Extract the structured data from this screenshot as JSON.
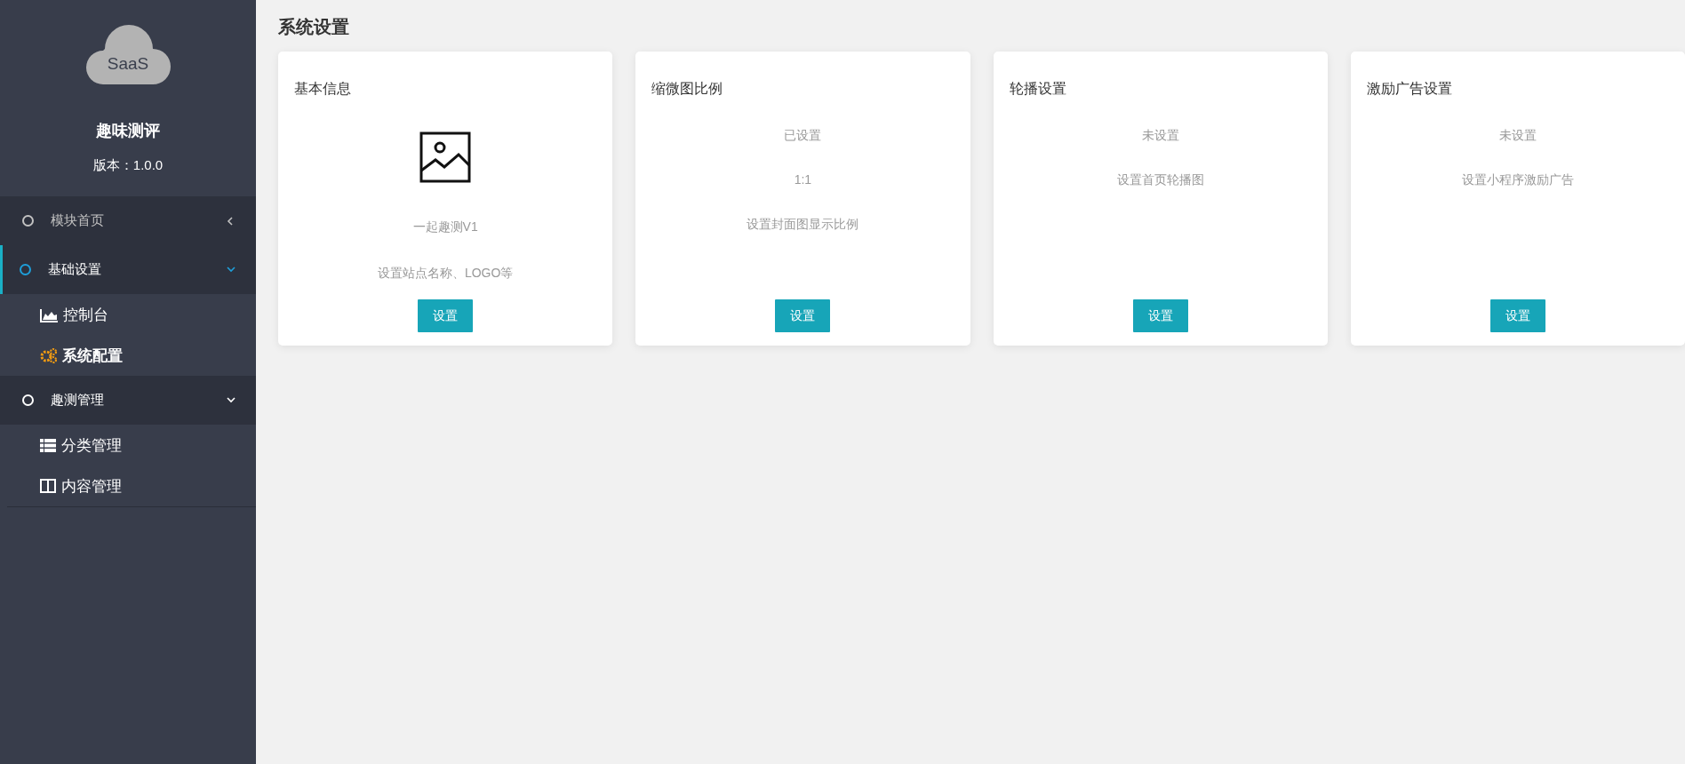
{
  "sidebar": {
    "logo": {
      "text": "SaaS"
    },
    "app_name": "趣味测评",
    "version": "版本：1.0.0",
    "menu": [
      {
        "label": "模块首页",
        "selected": false,
        "expanded": false
      },
      {
        "label": "基础设置",
        "selected": true,
        "expanded": true,
        "children": [
          {
            "label": "控制台",
            "kind": "chart",
            "selected": false
          },
          {
            "label": "系统配置",
            "kind": "gears",
            "selected": true
          }
        ]
      },
      {
        "label": "趣测管理",
        "selected": false,
        "expanded": true,
        "children": [
          {
            "label": "分类管理",
            "kind": "list",
            "selected": false
          },
          {
            "label": "内容管理",
            "kind": "columns",
            "selected": false
          }
        ]
      }
    ]
  },
  "page": {
    "title": "系统设置",
    "cards": [
      {
        "kind": "image",
        "title": "基本信息",
        "lines": [
          "一起趣测V1",
          "设置站点名称、LOGO等"
        ],
        "button": "设置"
      },
      {
        "kind": "text",
        "title": "缩微图比例",
        "lines": [
          "已设置",
          "1:1",
          "设置封面图显示比例"
        ],
        "button": "设置"
      },
      {
        "kind": "text",
        "title": "轮播设置",
        "lines": [
          "未设置",
          "设置首页轮播图"
        ],
        "button": "设置"
      },
      {
        "kind": "text",
        "title": "激励广告设置",
        "lines": [
          "未设置",
          "设置小程序激励广告"
        ],
        "button": "设置"
      }
    ]
  }
}
